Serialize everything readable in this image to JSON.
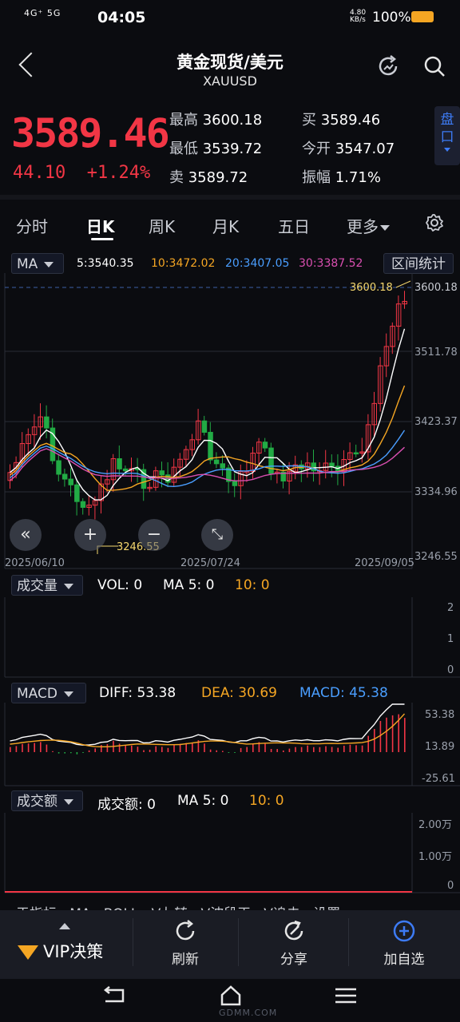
{
  "status": {
    "network": "4G⁺ 5G",
    "time": "04:05",
    "speed_value": "4.80",
    "speed_unit": "KB/s",
    "battery": "100%"
  },
  "header": {
    "title": "黄金现货/美元",
    "symbol": "XAUUSD"
  },
  "quote": {
    "price": "3589.46",
    "change": "44.10",
    "change_pct": "+1.24%",
    "high_label": "最高",
    "high": "3600.18",
    "low_label": "最低",
    "low": "3539.72",
    "sell_label": "卖",
    "sell": "3589.72",
    "buy_label": "买",
    "buy": "3589.46",
    "open_label": "今开",
    "open": "3547.07",
    "amp_label": "振幅",
    "amp": "1.71%",
    "panel_btn": "盘口"
  },
  "tabs": [
    {
      "label": "分时"
    },
    {
      "label": "日K"
    },
    {
      "label": "周K"
    },
    {
      "label": "月K"
    },
    {
      "label": "五日"
    },
    {
      "label": "更多"
    }
  ],
  "ma_bar": {
    "indicator": "MA",
    "ma5": "5:3540.35",
    "ma10": "10:3472.02",
    "ma20": "20:3407.05",
    "ma30": "30:3387.52",
    "range_btn": "区间统计"
  },
  "colors": {
    "up": "#f23645",
    "down": "#22ab45",
    "ma5": "#ffffff",
    "ma10": "#f5a623",
    "ma20": "#4a9eff",
    "ma30": "#d94fb0",
    "accent": "#3d7bf5"
  },
  "price_chart": {
    "y_ticks": [
      "3600.18",
      "3511.78",
      "3423.37",
      "3334.96",
      "3246.55"
    ],
    "x_labels": [
      "2025/06/10",
      "2025/07/24",
      "2025/09/05"
    ],
    "max_label": "3600.18",
    "min_label": "3246.55"
  },
  "volume": {
    "indicator": "成交量",
    "vol": "VOL: 0",
    "ma5": "MA 5: 0",
    "ma10": "10: 0",
    "y_ticks": [
      "2",
      "1",
      "0"
    ]
  },
  "macd": {
    "indicator": "MACD",
    "diff": "DIFF: 53.38",
    "dea": "DEA: 30.69",
    "macd": "MACD: 45.38",
    "y_ticks": [
      "53.38",
      "13.89",
      "-25.61"
    ]
  },
  "turnover": {
    "indicator": "成交额",
    "amount": "成交额: 0",
    "ma5": "MA 5: 0",
    "ma10": "10: 0",
    "y_ticks": [
      "2.00万",
      "1.00万",
      "0"
    ]
  },
  "cutoff_row": "于指标   MA   BOLL   V九转   V波段王   V追击   设置",
  "bottom_bar": {
    "vip": "VIP决策",
    "refresh": "刷新",
    "share": "分享",
    "add": "加自选"
  },
  "watermark": "GDMM.COM"
}
